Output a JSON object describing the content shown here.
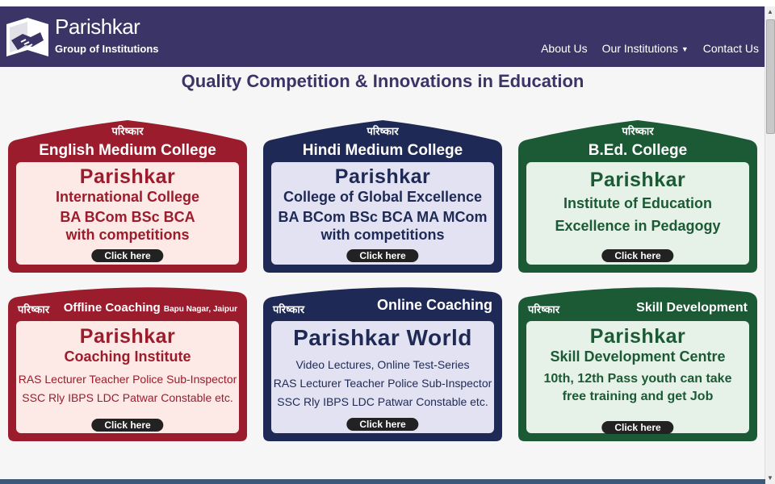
{
  "header": {
    "brand_name": "Parishkar",
    "brand_sub": "Group of Institutions",
    "nav": [
      "About Us",
      "Our Institutions",
      "Contact Us"
    ]
  },
  "headline": "Quality Competition & Innovations in Education",
  "cards": [
    {
      "tag": "परिष्कार",
      "head": "English Medium College",
      "brand": "Parishkar",
      "name": "International College",
      "line1": "BA BCom BSc BCA",
      "line2": "with competitions",
      "cta": "Click here",
      "color": "#9b1c2c",
      "fill": "#fde9e6"
    },
    {
      "tag": "परिष्कार",
      "head": "Hindi Medium College",
      "brand": "Parishkar",
      "name": "College of Global Excellence",
      "line1": "BA BCom BSc BCA MA MCom",
      "line2": "with competitions",
      "cta": "Click here",
      "color": "#1e2a55",
      "fill": "#e2e2f2"
    },
    {
      "tag": "परिष्कार",
      "head": "B.Ed. College",
      "brand": "Parishkar",
      "name": "Institute of Education",
      "line1": "Excellence in Pedagogy",
      "line2": "",
      "cta": "Click here",
      "color": "#1c5a36",
      "fill": "#e6f2e8"
    },
    {
      "tag": "परिष्कार",
      "head": "Offline Coaching",
      "head_small": "Bapu Nagar, Jaipur",
      "brand": "Parishkar",
      "name": "Coaching Institute",
      "line1": "RAS Lecturer Teacher Police Sub-Inspector",
      "line2": "SSC Rly IBPS LDC Patwar Constable etc.",
      "cta": "Click here",
      "color": "#9b1c2c",
      "fill": "#fde9e6"
    },
    {
      "tag": "परिष्कार",
      "head": "Online Coaching",
      "brand": "Parishkar World",
      "name": "Video Lectures, Online Test-Series",
      "line1": "RAS Lecturer Teacher Police Sub-Inspector",
      "line2": "SSC Rly IBPS LDC Patwar Constable etc.",
      "cta": "Click here",
      "color": "#1e2a55",
      "fill": "#e2e2f2"
    },
    {
      "tag": "परिष्कार",
      "head": "Skill Development",
      "brand": "Parishkar",
      "name": "Skill Development Centre",
      "line1": "10th, 12th Pass youth can take",
      "line2": "free training and get Job",
      "cta": "Click here",
      "color": "#1c5a36",
      "fill": "#e6f2e8"
    }
  ]
}
